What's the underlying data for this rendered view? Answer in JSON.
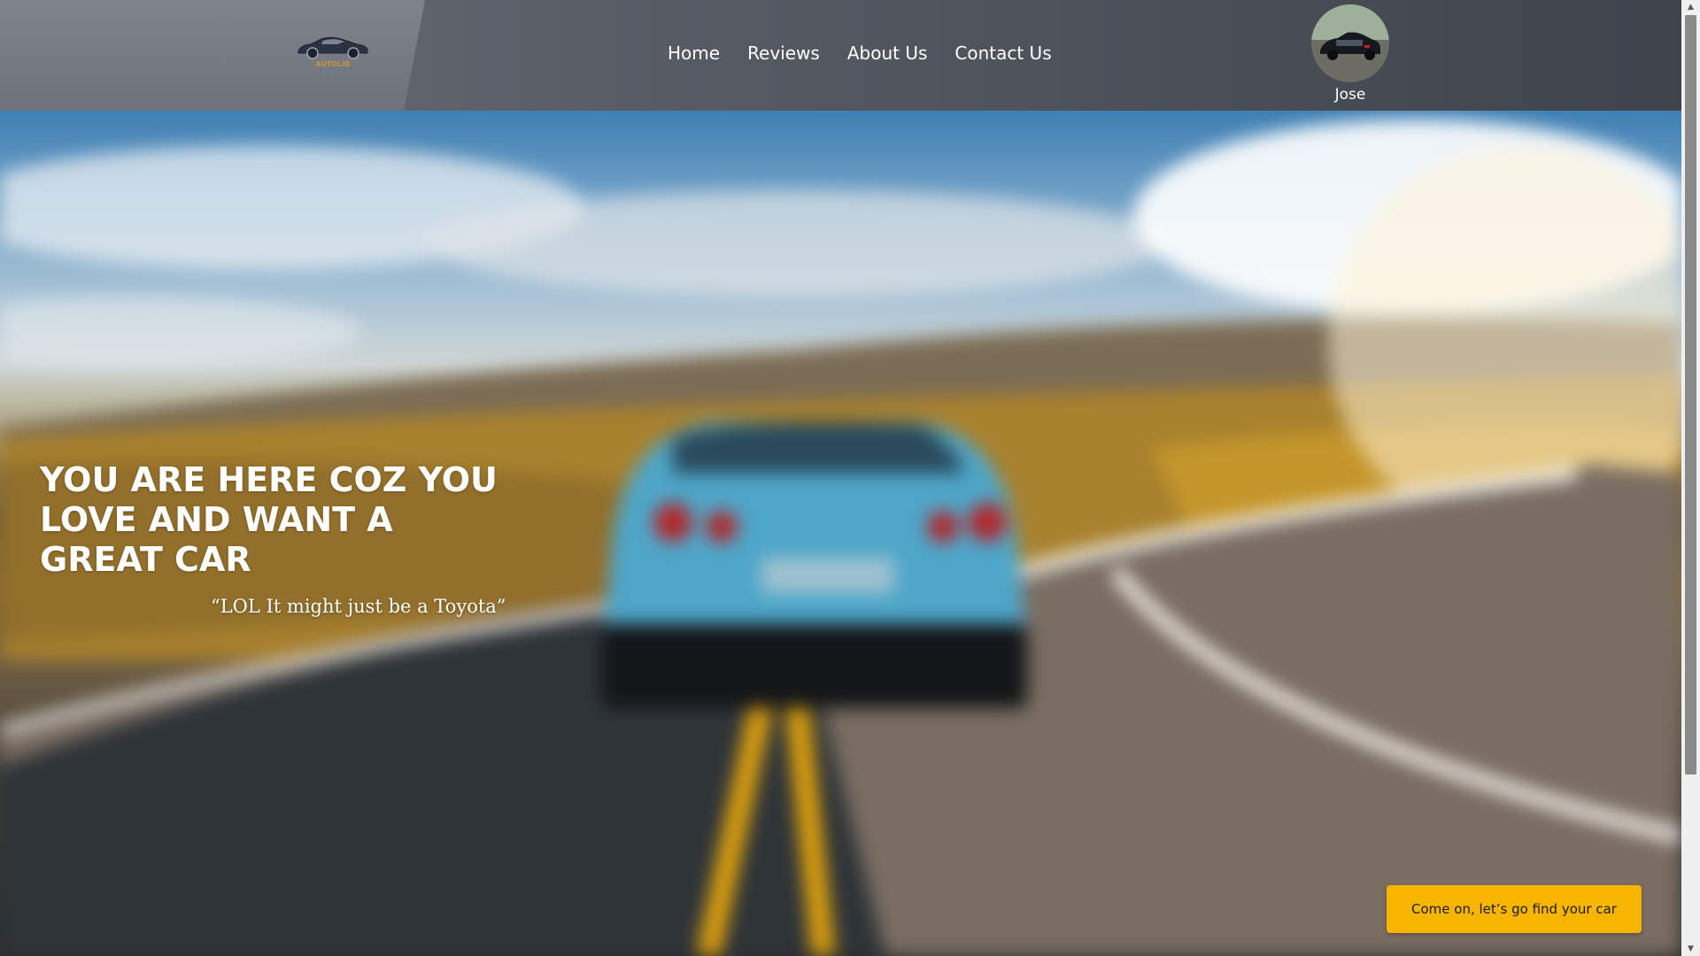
{
  "brand": {
    "logo_icon": "car-logo",
    "logo_text": "AUTOLIB",
    "logo_dots": "• • •"
  },
  "nav": {
    "items": [
      {
        "label": "Home"
      },
      {
        "label": "Reviews"
      },
      {
        "label": "About Us"
      },
      {
        "label": "Contact Us"
      }
    ]
  },
  "profile": {
    "name": "Jose",
    "avatar_icon": "avatar-car-photo"
  },
  "hero": {
    "headline": "YOU ARE HERE COZ YOU LOVE AND WANT A GREAT CAR",
    "quote": "“LOL It might just be a Toyota”",
    "cta_label": "Come on, let’s go find your car"
  },
  "colors": {
    "accent": "#f7b500",
    "nav_bg": "#4d525b",
    "text": "#ffffff"
  }
}
